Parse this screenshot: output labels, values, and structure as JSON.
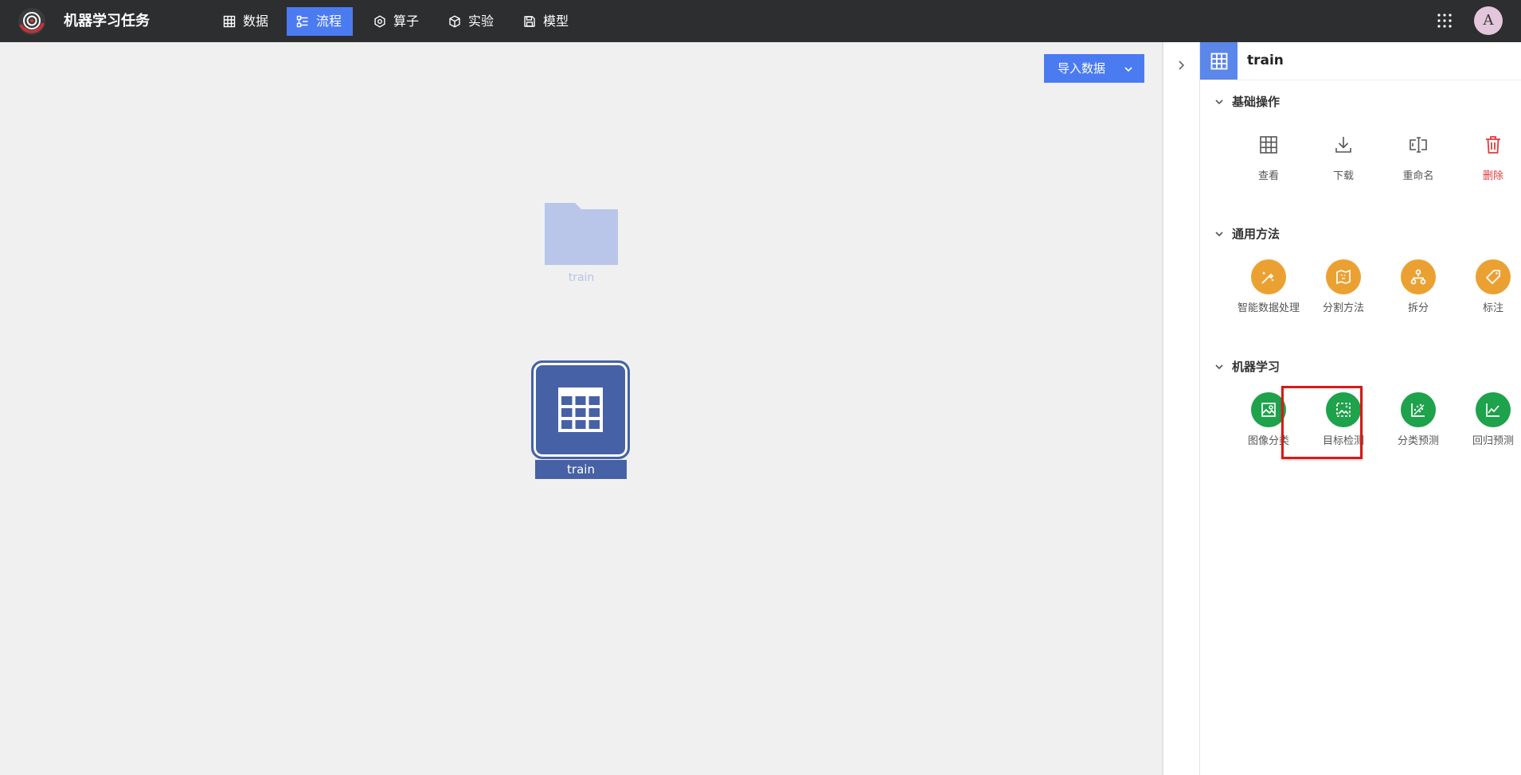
{
  "header": {
    "title": "机器学习任务",
    "tabs": [
      {
        "label": "数据",
        "icon": "table-icon",
        "active": false
      },
      {
        "label": "流程",
        "icon": "flow-icon",
        "active": true
      },
      {
        "label": "算子",
        "icon": "hexagon-icon",
        "active": false
      },
      {
        "label": "实验",
        "icon": "cube-icon",
        "active": false
      },
      {
        "label": "模型",
        "icon": "save-icon",
        "active": false
      }
    ],
    "avatar": "A",
    "accent_color": "#4a7bf0",
    "bar_color": "#2d2e30"
  },
  "canvas": {
    "import_button": "导入数据",
    "folder_label": "train",
    "node_label": "train",
    "node_color": "#4661a5"
  },
  "panel": {
    "title": "train",
    "sections": [
      {
        "title": "基础操作",
        "tools": [
          {
            "label": "查看",
            "icon": "table-icon"
          },
          {
            "label": "下载",
            "icon": "download-icon"
          },
          {
            "label": "重命名",
            "icon": "rename-icon"
          },
          {
            "label": "删除",
            "icon": "trash-icon"
          }
        ]
      },
      {
        "title": "通用方法",
        "tools": [
          {
            "label": "智能数据处理",
            "icon": "magic-pen-icon"
          },
          {
            "label": "分割方法",
            "icon": "map-icon"
          },
          {
            "label": "拆分",
            "icon": "split-tree-icon"
          },
          {
            "label": "标注",
            "icon": "tag-icon"
          }
        ]
      },
      {
        "title": "机器学习",
        "tools": [
          {
            "label": "图像分类",
            "icon": "image-classify-icon"
          },
          {
            "label": "目标检测",
            "icon": "object-detect-icon"
          },
          {
            "label": "分类预测",
            "icon": "scatter-predict-icon"
          },
          {
            "label": "回归预测",
            "icon": "line-chart-icon"
          }
        ]
      }
    ],
    "orange": "#eba132",
    "green": "#1ea24c",
    "delete_red": "#e23b3b"
  }
}
